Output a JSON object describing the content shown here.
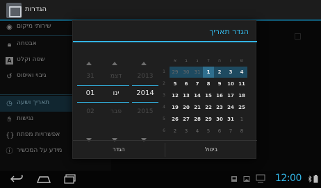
{
  "app": {
    "title": "הגדרות"
  },
  "sidebar": {
    "items": [
      {
        "label": "שירותי מיקום",
        "icon": "location-icon"
      },
      {
        "label": "אבטחה",
        "icon": "lock-icon"
      },
      {
        "label": "שפה וקלט",
        "icon": "keyboard-icon"
      },
      {
        "label": "גיבוי ואיפוס",
        "icon": "backup-icon"
      },
      {
        "label": "תאריך ושעה",
        "icon": "clock-icon",
        "active": true
      },
      {
        "label": "נגישות",
        "icon": "hand-icon"
      },
      {
        "label": "אפשרויות מפתח",
        "icon": "braces-icon"
      },
      {
        "label": "מידע על המכשיר",
        "icon": "info-icon"
      }
    ]
  },
  "dialog": {
    "title": "הגדר תאריך",
    "spinners": {
      "year": {
        "prev": "2013",
        "current": "2014",
        "next": "2015"
      },
      "month": {
        "prev": "דצמ",
        "current": "ינו",
        "next": "פבר"
      },
      "day": {
        "prev": "31",
        "current": "01",
        "next": "02"
      }
    },
    "calendar": {
      "weekday_headers": [
        "א",
        "ב",
        "ג",
        "ד",
        "ה",
        "ו",
        "ש"
      ],
      "weeks": [
        {
          "num": "1",
          "days": [
            "29",
            "30",
            "31",
            "1",
            "2",
            "3",
            "4"
          ]
        },
        {
          "num": "2",
          "days": [
            "5",
            "6",
            "7",
            "8",
            "9",
            "10",
            "11"
          ]
        },
        {
          "num": "3",
          "days": [
            "12",
            "13",
            "14",
            "15",
            "16",
            "17",
            "18"
          ]
        },
        {
          "num": "4",
          "days": [
            "19",
            "20",
            "21",
            "22",
            "23",
            "24",
            "25"
          ]
        },
        {
          "num": "5",
          "days": [
            "26",
            "27",
            "28",
            "29",
            "30",
            "31",
            "1"
          ]
        },
        {
          "num": "6",
          "days": [
            "2",
            "3",
            "4",
            "5",
            "6",
            "7",
            "8"
          ]
        }
      ],
      "selected_day": "1"
    },
    "buttons": {
      "cancel": "ביטול",
      "confirm": "הגדר"
    }
  },
  "statusbar": {
    "time": "12:00"
  },
  "colors": {
    "accent": "#33b5e5",
    "selected_week": "#1e4a60",
    "selected_day": "#2f6f8e"
  }
}
